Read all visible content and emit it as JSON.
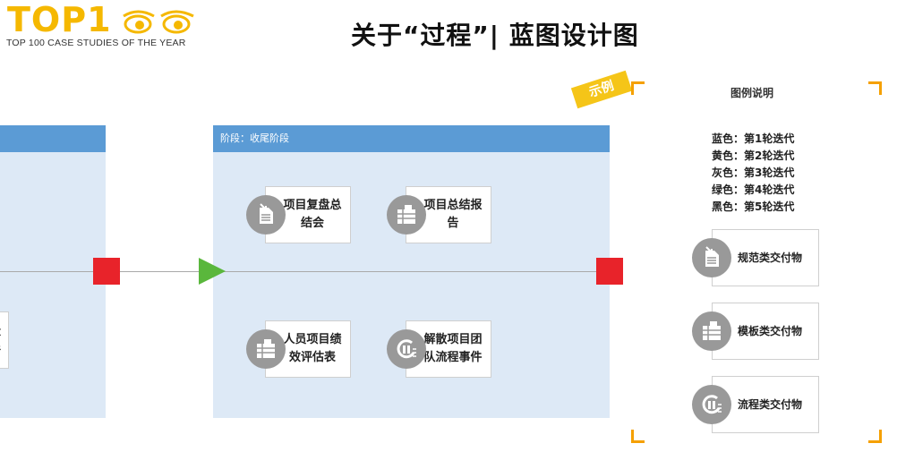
{
  "logo": {
    "wordmark": "TOP1",
    "tagline": "TOP 100 CASE STUDIES OF THE YEAR"
  },
  "title": "关于“过程”| 蓝图设计图",
  "stages": [
    {
      "header": "阶段：收尾阶段",
      "cards": [
        {
          "label": "项目复盘总结会",
          "icon": "document-arrow-icon"
        },
        {
          "label": "项目总结报告",
          "icon": "template-form-icon"
        },
        {
          "label": "人员项目绩效评估表",
          "icon": "template-form-icon"
        },
        {
          "label": "解散项目团队流程事件",
          "icon": "process-cycle-icon"
        }
      ]
    }
  ],
  "left_partial_card": {
    "text_line1": "盘",
    "text_line2": "件"
  },
  "sample_tag": "示例",
  "legend": {
    "title": "图例说明",
    "colors": [
      {
        "text": "蓝色：第1轮迭代"
      },
      {
        "text": "黄色：第2轮迭代"
      },
      {
        "text": "灰色：第3轮迭代"
      },
      {
        "text": "绿色：第4轮迭代"
      },
      {
        "text": "黑色：第5轮迭代"
      }
    ],
    "items": [
      {
        "label": "规范类交付物",
        "icon": "document-arrow-icon"
      },
      {
        "label": "模板类交付物",
        "icon": "template-form-icon"
      },
      {
        "label": "流程类交付物",
        "icon": "process-cycle-icon"
      }
    ]
  },
  "colors": {
    "stage_header": "#5b9bd5",
    "stage_body": "#dde9f6",
    "end_marker": "#e8232a",
    "start_marker": "#5ab73c",
    "icon_gray": "#999999",
    "accent_orange": "#f5a000"
  }
}
